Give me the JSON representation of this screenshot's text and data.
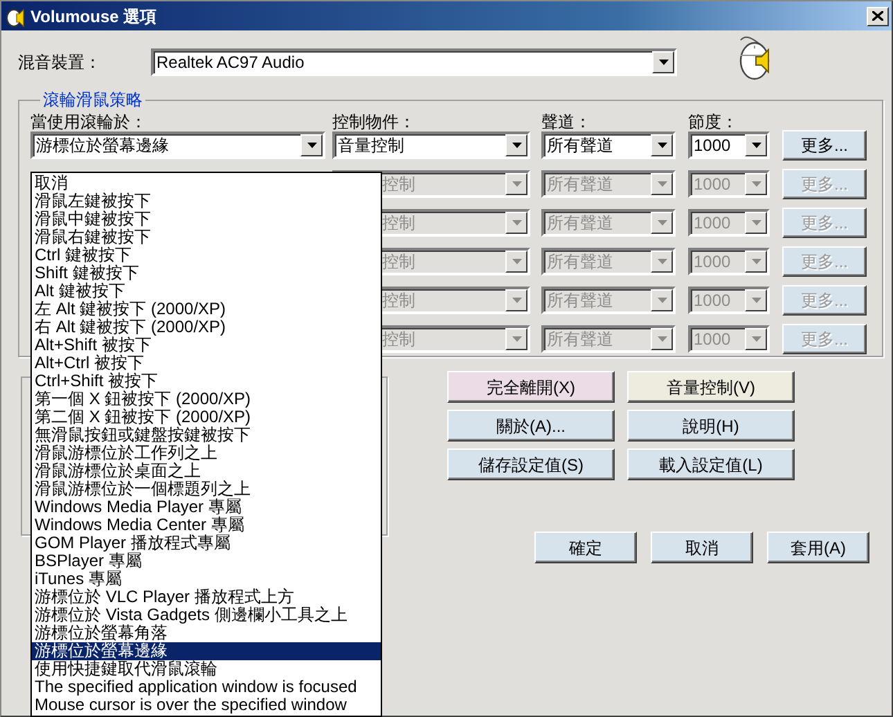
{
  "window": {
    "title": "Volumouse 選項"
  },
  "mixer": {
    "label": "混音裝置：",
    "value": "Realtek AC97 Audio"
  },
  "policy_group": {
    "title": "滾輪滑鼠策略",
    "columns": [
      "當使用滾輪於：",
      "控制物件：",
      "聲道：",
      "節度："
    ],
    "rows": [
      {
        "trigger": "游標位於螢幕邊緣",
        "control": "音量控制",
        "channel": "所有聲道",
        "step": "1000",
        "more": "更多...",
        "disabled": false
      },
      {
        "control": "控制",
        "channel": "所有聲道",
        "step": "1000",
        "more": "更多...",
        "disabled": true
      },
      {
        "control": "控制",
        "channel": "所有聲道",
        "step": "1000",
        "more": "更多...",
        "disabled": true
      },
      {
        "control": "控制",
        "channel": "所有聲道",
        "step": "1000",
        "more": "更多...",
        "disabled": true
      },
      {
        "control": "控制",
        "channel": "所有聲道",
        "step": "1000",
        "more": "更多...",
        "disabled": true
      },
      {
        "control": "控制",
        "channel": "所有聲道",
        "step": "1000",
        "more": "更多...",
        "disabled": true
      }
    ]
  },
  "trigger_list": [
    {
      "label": "取消",
      "selected": false
    },
    {
      "label": "滑鼠左鍵被按下",
      "selected": false
    },
    {
      "label": "滑鼠中鍵被按下",
      "selected": false
    },
    {
      "label": "滑鼠右鍵被按下",
      "selected": false
    },
    {
      "label": "Ctrl 鍵被按下",
      "selected": false
    },
    {
      "label": "Shift 鍵被按下",
      "selected": false
    },
    {
      "label": "Alt 鍵被按下",
      "selected": false
    },
    {
      "label": "左 Alt 鍵被按下  (2000/XP)",
      "selected": false
    },
    {
      "label": "右 Alt 鍵被按下  (2000/XP)",
      "selected": false
    },
    {
      "label": "Alt+Shift 被按下",
      "selected": false
    },
    {
      "label": "Alt+Ctrl 被按下",
      "selected": false
    },
    {
      "label": "Ctrl+Shift 被按下",
      "selected": false
    },
    {
      "label": "第一個 X 鈕被按下  (2000/XP)",
      "selected": false
    },
    {
      "label": "第二個 X 鈕被按下  (2000/XP)",
      "selected": false
    },
    {
      "label": "無滑鼠按鈕或鍵盤按鍵被按下",
      "selected": false
    },
    {
      "label": "滑鼠游標位於工作列之上",
      "selected": false
    },
    {
      "label": "滑鼠游標位於桌面之上",
      "selected": false
    },
    {
      "label": "滑鼠游標位於一個標題列之上",
      "selected": false
    },
    {
      "label": "Windows Media Player 專屬",
      "selected": false
    },
    {
      "label": "Windows Media Center 專屬",
      "selected": false
    },
    {
      "label": "GOM Player 播放程式專屬",
      "selected": false
    },
    {
      "label": "BSPlayer 專屬",
      "selected": false
    },
    {
      "label": "iTunes 專屬",
      "selected": false
    },
    {
      "label": "游標位於 VLC Player 播放程式上方",
      "selected": false
    },
    {
      "label": "游標位於 Vista Gadgets 側邊欄小工具之上",
      "selected": false
    },
    {
      "label": "游標位於螢幕角落",
      "selected": false
    },
    {
      "label": "游標位於螢幕邊緣",
      "selected": true
    },
    {
      "label": "使用快捷鍵取代滑鼠滾輪",
      "selected": false
    },
    {
      "label": "The specified application window is focused",
      "selected": false
    },
    {
      "label": "Mouse cursor is over the specified window",
      "selected": false
    }
  ],
  "action_buttons": [
    {
      "label": "完全離開(X)",
      "color": "#ecdce6"
    },
    {
      "label": "音量控制(V)",
      "color": "#eeecdf"
    },
    {
      "label": "關於(A)...",
      "color": "#d6e2ec"
    },
    {
      "label": "說明(H)",
      "color": "#d6e2ec"
    },
    {
      "label": "儲存設定值(S)",
      "color": "#d6e2ec"
    },
    {
      "label": "載入設定值(L)",
      "color": "#d6e2ec"
    }
  ],
  "dialog_buttons": [
    "確定",
    "取消",
    "套用(A)"
  ]
}
